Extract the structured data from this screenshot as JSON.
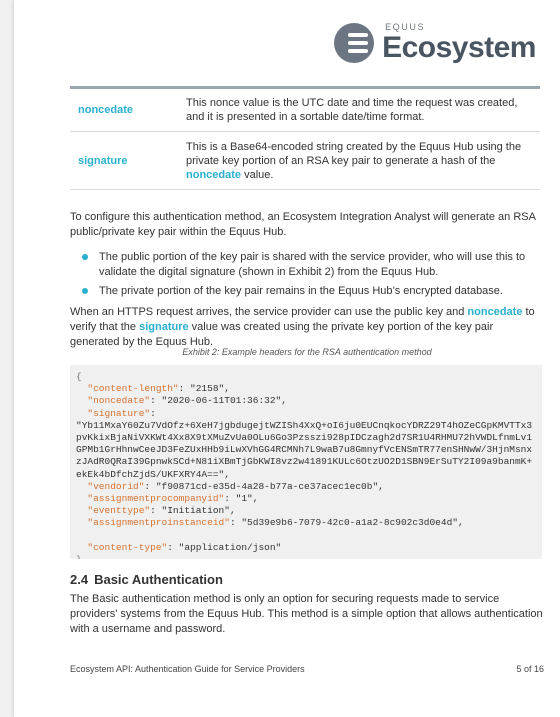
{
  "logo": {
    "small": "EQUUS",
    "big": "Ecosystem"
  },
  "definitions": [
    {
      "term": "noncedate",
      "desc_parts": [
        {
          "t": "This nonce value is the UTC date and time the request was created, and it is presented in a sortable date/time format.",
          "hl": false
        }
      ]
    },
    {
      "term": "signature",
      "desc_parts": [
        {
          "t": "This is a Base64-encoded string created by the Equus Hub using the private key portion of an RSA key pair to generate a hash of the ",
          "hl": false
        },
        {
          "t": "noncedate",
          "hl": true
        },
        {
          "t": " value.",
          "hl": false
        }
      ]
    }
  ],
  "para1": "To configure this authentication method, an Ecosystem Integration Analyst will generate an RSA public/private key pair within the Equus Hub.",
  "bullets": [
    "The public portion of the key pair is shared with the service provider, who will use this to validate the digital signature (shown in Exhibit 2) from the Equus Hub.",
    "The private portion of the key pair remains in the Equus Hub’s encrypted database."
  ],
  "para2_parts": [
    {
      "t": "When an HTTPS request arrives, the service provider can use the public key and ",
      "hl": false
    },
    {
      "t": "noncedate",
      "hl": true
    },
    {
      "t": " to verify that the ",
      "hl": false
    },
    {
      "t": "signature",
      "hl": true
    },
    {
      "t": " value was created using the private key portion of the key pair generated by the Equus Hub.",
      "hl": false
    }
  ],
  "caption": "Exhibit 2: Example headers for the RSA authentication method",
  "code": {
    "open": "{",
    "close": "}",
    "entries": [
      {
        "key": "\"content-length\"",
        "sep": ": ",
        "val": "\"2158\",",
        "wrap": false
      },
      {
        "key": "\"noncedate\"",
        "sep": ": ",
        "val": "\"2020-06-11T01:36:32\",",
        "wrap": false
      },
      {
        "key": "\"signature\"",
        "sep": ":",
        "val": "\"Yb11MxaY60Zu7VdOfz+6XeH7jgbdugejtWZISh4XxQ+oI6ju0EUCnqkocYDRZ29T4hOZeCGpKMVTTx3pvKkixBjaNiVXKWt4Xx8X9tXMuZvUa0OLu6Go3Pzsszi928pIDCzagh2d7SR1U4RHMU72hVWDLfnmLv1GPMb1GrHhnwCeeJD3FeZUxHHb9iLwXVhGG4RCMNh7L9waB7u8GmnyfVcENSmTR77enSHNwW/3HjnMsnxzJAdR0QRaI39GpnwkSCd+N81iXBmTjGbKWI8vz2w41891KULc6OtzUO2D1SBN9ErSuTY2I09a9banmK+ekEk4bDfchZjdS/UKFXRY4A==\",",
        "wrap": true
      },
      {
        "key": "\"vendorid\"",
        "sep": ": ",
        "val": "\"f90871cd-e35d-4a28-b77a-ce37acec1ec0b\",",
        "wrap": false
      },
      {
        "key": "\"assignmentprocompanyid\"",
        "sep": ": ",
        "val": "\"1\",",
        "wrap": false
      },
      {
        "key": "\"eventtype\"",
        "sep": ": ",
        "val": "\"Initiation\",",
        "wrap": false
      },
      {
        "key": "\"assignmentproinstanceid\"",
        "sep": ": ",
        "val": "\"5d39e9b6-7079-42c0-a1a2-8c902c3d0e4d\",",
        "wrap": false
      },
      {
        "key": "",
        "sep": "",
        "val": "",
        "wrap": false
      },
      {
        "key": "\"content-type\"",
        "sep": ": ",
        "val": "\"application/json\"",
        "wrap": false
      }
    ]
  },
  "section": {
    "number": "2.4",
    "title": "Basic Authentication"
  },
  "para3": "The Basic authentication method is only an option for securing requests made to service providers’ systems from the Equus Hub. This method is a simple option that allows authentication with a username and password.",
  "footer": {
    "left": "Ecosystem API: Authentication Guide for Service Providers",
    "right": "5 of 16"
  },
  "colors": {
    "accent": "#2ab0cf",
    "code_key": "#d6722f",
    "rule": "#9aa5af"
  }
}
